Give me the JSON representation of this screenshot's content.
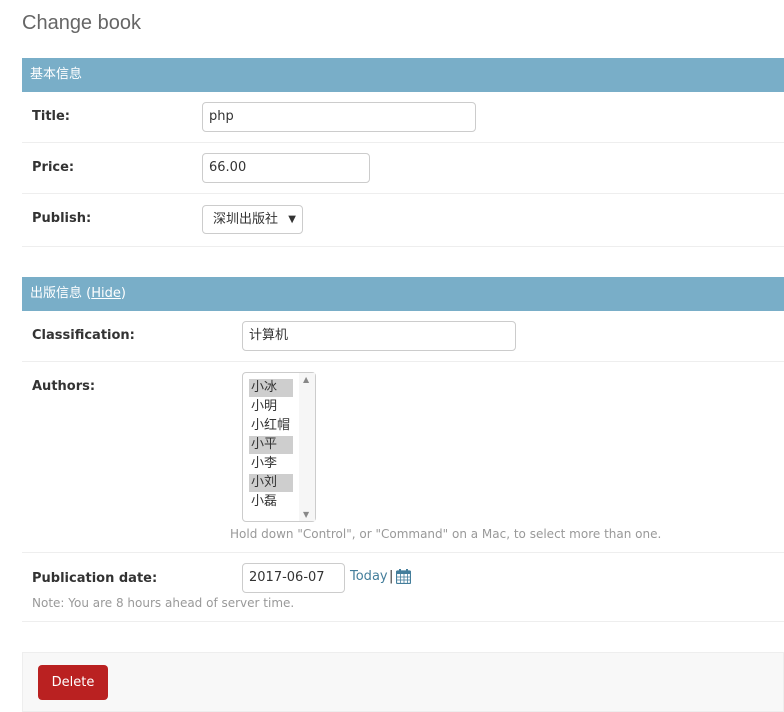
{
  "page": {
    "title": "Change book"
  },
  "fieldset_basic": {
    "header": "基本信息",
    "title_label": "Title:",
    "title_value": "php",
    "price_label": "Price:",
    "price_value": "66.00",
    "publish_label": "Publish:",
    "publish_value": "深圳出版社"
  },
  "fieldset_pub": {
    "header": "出版信息",
    "toggle_open": " (",
    "toggle_link": "Hide",
    "toggle_close": ")",
    "classification_label": "Classification:",
    "classification_value": "计算机",
    "authors_label": "Authors:",
    "authors": [
      {
        "name": "小冰",
        "selected": true
      },
      {
        "name": "小明",
        "selected": false
      },
      {
        "name": "小红帽",
        "selected": false
      },
      {
        "name": "小平",
        "selected": true
      },
      {
        "name": "小李",
        "selected": false
      },
      {
        "name": "小刘",
        "selected": true
      },
      {
        "name": "小磊",
        "selected": false
      }
    ],
    "authors_help": "Hold down \"Control\", or \"Command\" on a Mac, to select more than one.",
    "pubdate_label": "Publication date:",
    "pubdate_value": "2017-06-07",
    "today_label": "Today",
    "separator": "|",
    "timezone_note": "Note: You are 8 hours ahead of server time."
  },
  "actions": {
    "delete_label": "Delete"
  },
  "icons": {
    "calendar": "calendar-icon"
  },
  "colors": {
    "header": "#79aec8",
    "delete": "#ba2121",
    "link": "#447e9b"
  }
}
